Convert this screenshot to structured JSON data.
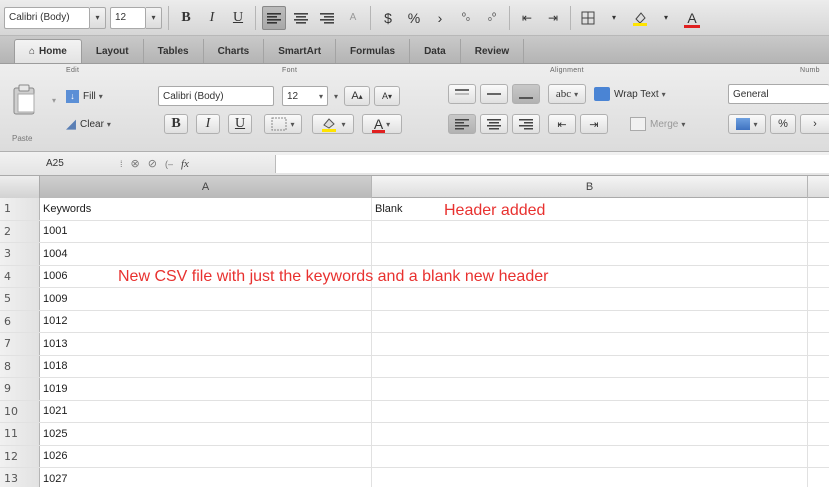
{
  "format_bar": {
    "font_name": "Calibri (Body)",
    "font_size": "12",
    "bold_label": "B",
    "italic_label": "I",
    "underline_label": "U",
    "currency_label": "$",
    "percent_label": "%",
    "comma_label": "›"
  },
  "tabs": [
    {
      "label": "Home",
      "active": true
    },
    {
      "label": "Layout"
    },
    {
      "label": "Tables"
    },
    {
      "label": "Charts"
    },
    {
      "label": "SmartArt"
    },
    {
      "label": "Formulas"
    },
    {
      "label": "Data"
    },
    {
      "label": "Review"
    }
  ],
  "ribbon": {
    "groups": {
      "edit": "Edit",
      "font": "Font",
      "alignment": "Alignment",
      "number": "Numb"
    },
    "paste_label": "Paste",
    "fill_label": "Fill",
    "clear_label": "Clear",
    "font_name": "Calibri (Body)",
    "font_size": "12",
    "grow_font": "A",
    "shrink_font": "A",
    "bold_label": "B",
    "italic_label": "I",
    "underline_label": "U",
    "font_color_label": "A",
    "abc_label": "abc",
    "wrap_text_label": "Wrap Text",
    "merge_label": "Merge",
    "number_format": "General",
    "percent_label": "%"
  },
  "formula_bar": {
    "cell_ref": "A25",
    "fx_label": "fx",
    "formula_value": ""
  },
  "columns": [
    {
      "label": "A",
      "selected": true
    },
    {
      "label": "B"
    }
  ],
  "rows": [
    {
      "num": "1",
      "a": "Keywords",
      "b": "Blank"
    },
    {
      "num": "2",
      "a": "1001",
      "b": ""
    },
    {
      "num": "3",
      "a": "1004",
      "b": ""
    },
    {
      "num": "4",
      "a": "1006",
      "b": ""
    },
    {
      "num": "5",
      "a": "1009",
      "b": ""
    },
    {
      "num": "6",
      "a": "1012",
      "b": ""
    },
    {
      "num": "7",
      "a": "1013",
      "b": ""
    },
    {
      "num": "8",
      "a": "1018",
      "b": ""
    },
    {
      "num": "9",
      "a": "1019",
      "b": ""
    },
    {
      "num": "10",
      "a": "1021",
      "b": ""
    },
    {
      "num": "11",
      "a": "1025",
      "b": ""
    },
    {
      "num": "12",
      "a": "1026",
      "b": ""
    },
    {
      "num": "13",
      "a": "1027",
      "b": ""
    }
  ],
  "annotations": {
    "header_added": "Header added",
    "csv_note": "New CSV file with just the keywords and a blank new header"
  },
  "colors": {
    "annotation": "#e8312f",
    "selected_header": "#c4c4c4"
  }
}
